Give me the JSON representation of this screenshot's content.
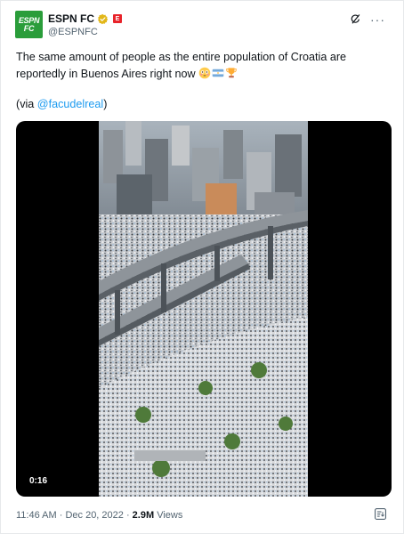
{
  "author": {
    "avatar_line1": "ESPN",
    "avatar_line2": "FC",
    "display_name": "ESPN FC",
    "handle": "@ESPNFC",
    "affiliate_badge": "E"
  },
  "tweet": {
    "text": "The same amount of people as the entire population of Croatia are reportedly in Buenos Aires right now",
    "emojis": [
      "flushed-face",
      "argentina-flag",
      "trophy"
    ],
    "via_prefix": "(via ",
    "via_mention": "@facudelreal",
    "via_suffix": ")"
  },
  "media": {
    "video_time": "0:16"
  },
  "meta": {
    "time": "11:46 AM",
    "separator": " · ",
    "date": "Dec 20, 2022",
    "views_count": "2.9M",
    "views_label": " Views"
  },
  "icons": {
    "verified": "verified-badge-icon",
    "grok": "grok-icon",
    "more": "more-icon",
    "analytics": "analytics-icon"
  },
  "colors": {
    "verified_gold": "#e2b719",
    "mention_blue": "#1d9bf0",
    "avatar_green": "#2a9d3a",
    "affiliate_red": "#e8232a",
    "muted_text": "#536471"
  }
}
